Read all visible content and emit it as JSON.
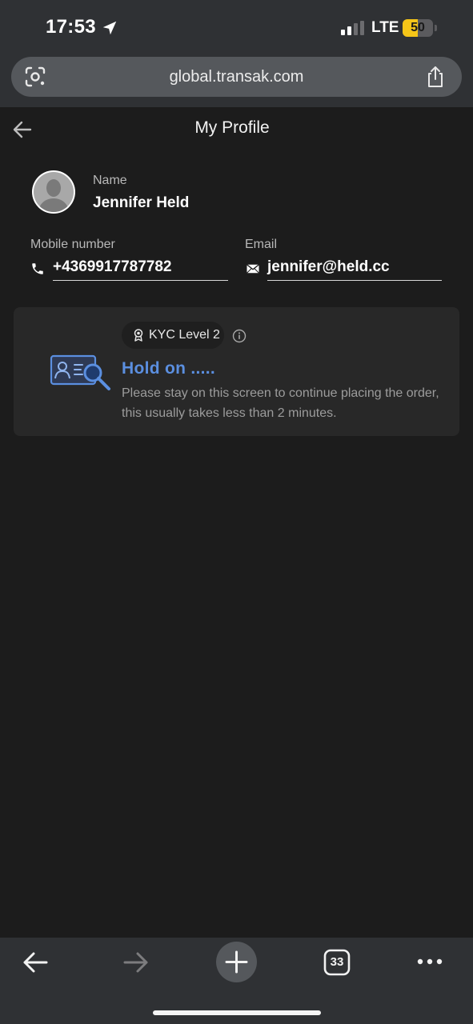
{
  "status_bar": {
    "time": "17:53",
    "network": "LTE",
    "battery": "50",
    "battery_level": 0.5,
    "battery_color": "#f5c518"
  },
  "browser": {
    "url": "global.transak.com",
    "tab_count": "33"
  },
  "header": {
    "title": "My Profile"
  },
  "profile": {
    "name_label": "Name",
    "name": "Jennifer Held",
    "mobile_label": "Mobile number",
    "mobile": "+4369917787782",
    "email_label": "Email",
    "email": "jennifer@held.cc"
  },
  "kyc": {
    "level": "KYC Level 2",
    "status_title": "Hold on .....",
    "status_desc": "Please stay on this screen to continue placing the order, this usually takes less than 2 minutes.",
    "accent_color": "#5b8fe0"
  },
  "icons": {
    "location": "location-arrow-icon",
    "lens": "camera-lens-icon",
    "share": "share-icon",
    "back": "back-arrow-icon",
    "avatar": "user-avatar-icon",
    "phone": "phone-icon",
    "mail": "mail-icon",
    "badge": "award-badge-icon",
    "info": "info-icon",
    "id_search": "id-card-search-icon",
    "nav_back": "back-arrow-icon",
    "nav_forward": "forward-arrow-icon",
    "new_tab": "plus-icon",
    "more": "more-dots-icon"
  }
}
